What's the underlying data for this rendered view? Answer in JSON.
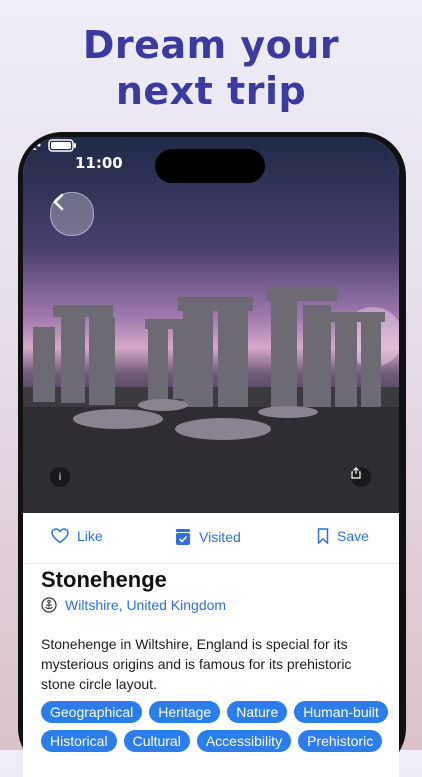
{
  "headline": {
    "line1": "Dream your",
    "line2": "next trip"
  },
  "status_bar": {
    "time": "11:00"
  },
  "actions": {
    "like": "Like",
    "visited": "Visited",
    "save": "Save"
  },
  "place": {
    "title": "Stonehenge",
    "location": "Wiltshire, United Kingdom",
    "description": "Stonehenge in Wiltshire, England is special for its mysterious origins and is famous for its prehistoric stone circle layout."
  },
  "tags": {
    "row1": [
      "Geographical",
      "Heritage",
      "Nature",
      "Human-built"
    ],
    "row2": [
      "Historical",
      "Cultural",
      "Accessibility",
      "Prehistoric"
    ]
  },
  "colors": {
    "accent": "#2f6fe0",
    "tag_bg": "#2b7de9",
    "headline": "#3a3aa0"
  }
}
